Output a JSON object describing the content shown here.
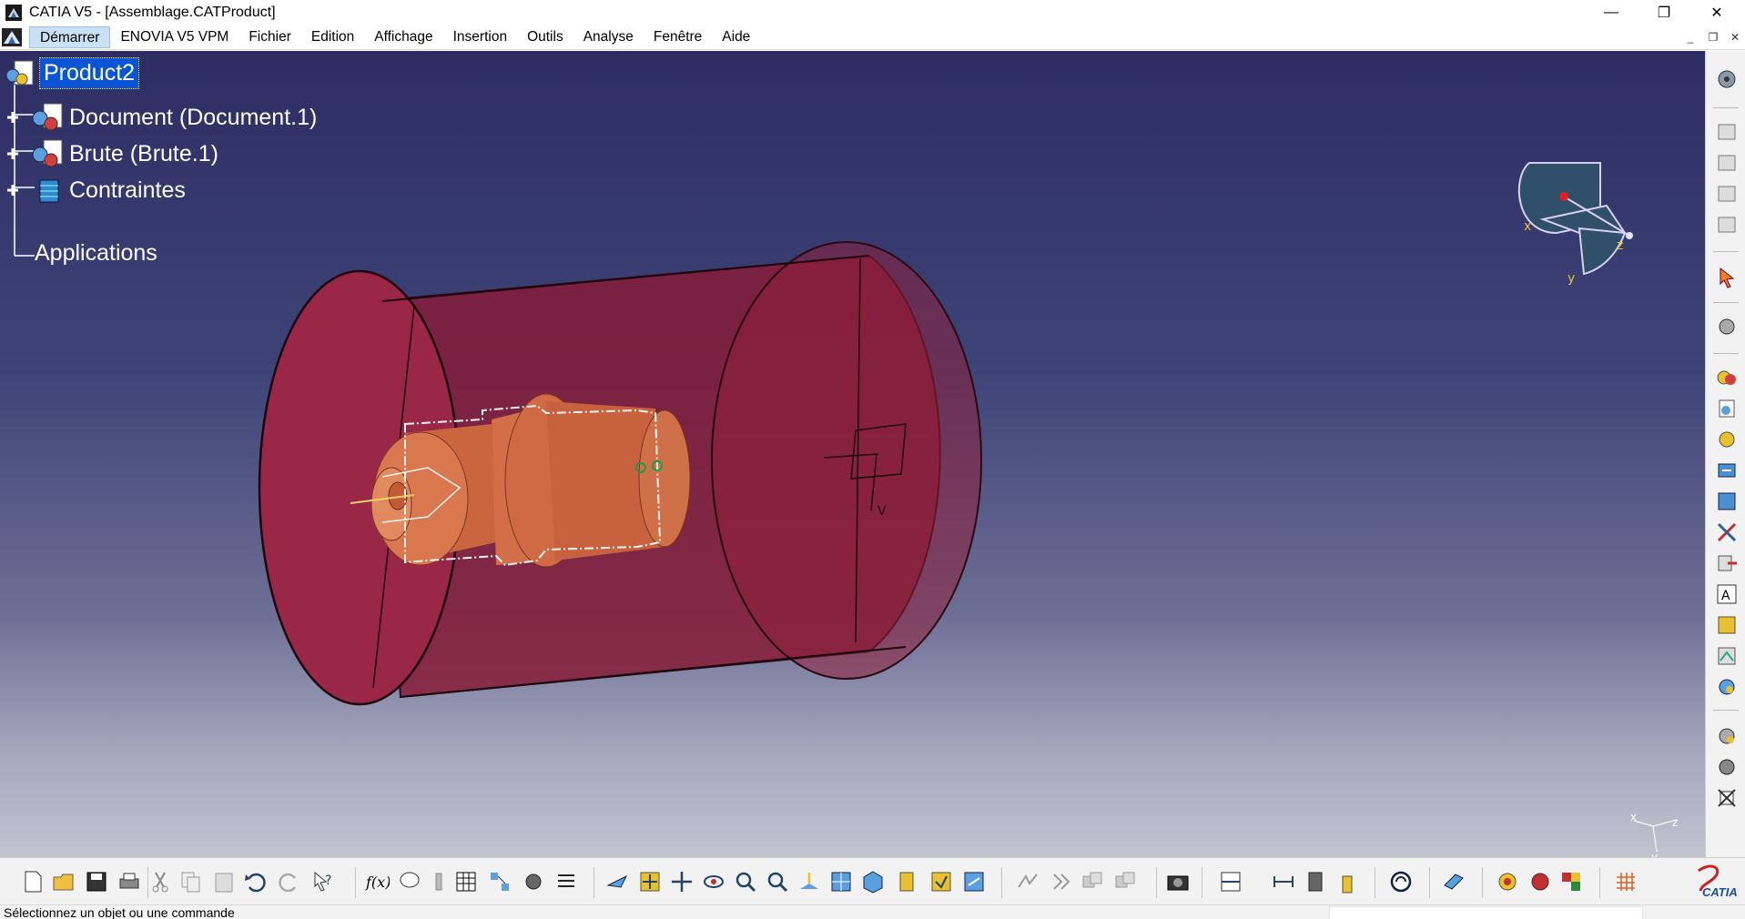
{
  "window": {
    "title": "CATIA V5 - [Assemblage.CATProduct]",
    "controls": [
      "minimize-icon",
      "restore-icon",
      "close-icon"
    ]
  },
  "menubar": {
    "items": [
      "Démarrer",
      "ENOVIA V5 VPM",
      "Fichier",
      "Edition",
      "Affichage",
      "Insertion",
      "Outils",
      "Analyse",
      "Fenêtre",
      "Aide"
    ]
  },
  "tree": {
    "root": "Product2",
    "nodes": [
      {
        "label": "Document (Document.1)",
        "icon": "part-icon"
      },
      {
        "label": "Brute (Brute.1)",
        "icon": "part-icon"
      },
      {
        "label": "Contraintes",
        "icon": "constraints-icon"
      },
      {
        "label": "Applications",
        "icon": ""
      }
    ]
  },
  "compass": {
    "x_label": "x",
    "y_label": "y",
    "z_label": "z"
  },
  "axis_indicator": {
    "x": "x",
    "y": "y",
    "z": "z"
  },
  "status": {
    "text": "Sélectionnez un objet ou une commande"
  },
  "brand": {
    "logo_text": "CATIA"
  },
  "colors": {
    "viewport_top": "#2d2d63",
    "viewport_bottom": "#c2c2d0",
    "solid_red": "#8b1e3a",
    "part_orange": "#d9764e",
    "selection_blue": "#0a55d6"
  },
  "right_toolbar_icons": [
    "compass-icon",
    "view-1-icon",
    "view-2-icon",
    "view-3-icon",
    "view-4-icon",
    "select-icon",
    "move-icon",
    "product-1-icon",
    "product-2-icon",
    "product-3-icon",
    "existing-component-icon",
    "replace-icon",
    "explode-icon",
    "multi-instantiate-icon",
    "text-icon",
    "assembly-feature-icon",
    "scene-icon",
    "catalog-icon",
    "manipulate-icon",
    "snap-icon",
    "fix-icon"
  ],
  "bottom_toolbar_icons": [
    "new-icon",
    "open-icon",
    "save-icon",
    "print-icon",
    "cut-icon",
    "copy-icon",
    "paste-icon",
    "undo-icon",
    "redo-icon",
    "whats-this-icon",
    "formula-icon",
    "comment-icon",
    "plug-icon",
    "table-icon",
    "graph-icon",
    "knowledge-icon",
    "list-icon",
    "fly-icon",
    "fit-all-icon",
    "pan-icon",
    "rotate-icon",
    "zoom-in-icon",
    "zoom-out-icon",
    "normal-view-icon",
    "multi-view-icon",
    "iso-view-icon",
    "shading-icon",
    "hide-show-icon",
    "swap-icon",
    "update-icon",
    "update-2-icon",
    "constraint-1-icon",
    "constraint-2-icon",
    "camera-icon",
    "measure-1-icon",
    "measure-2-icon",
    "measure-3-icon",
    "measure-4-icon",
    "sync-icon",
    "plane-icon",
    "render-1-icon",
    "render-2-icon",
    "render-3-icon",
    "grid-icon",
    "catia-logo"
  ]
}
